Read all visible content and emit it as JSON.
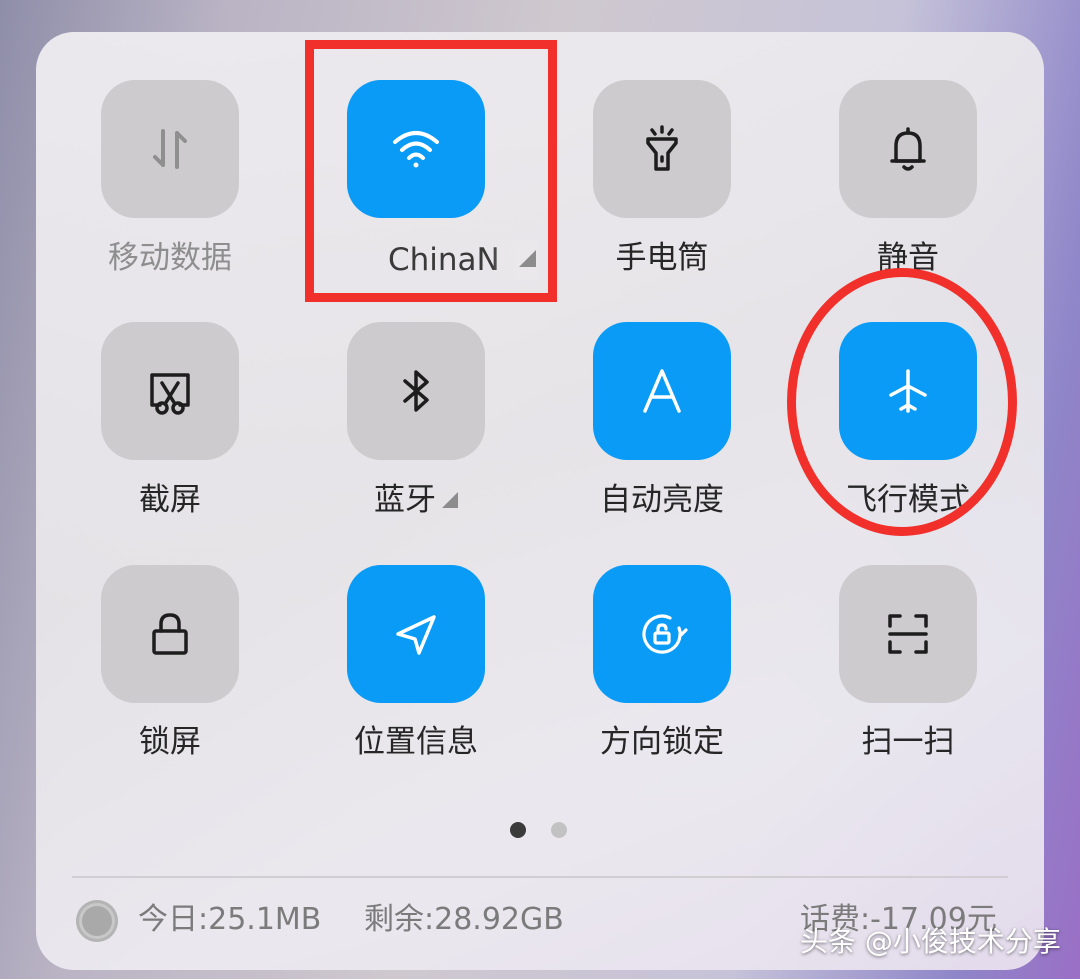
{
  "tiles": [
    {
      "id": "mobile-data",
      "label": "移动数据",
      "icon": "mobile-data-icon",
      "active": false
    },
    {
      "id": "wifi",
      "label": "ChinaN",
      "icon": "wifi-icon",
      "active": true
    },
    {
      "id": "flashlight",
      "label": "手电筒",
      "icon": "flashlight-icon",
      "active": false
    },
    {
      "id": "mute",
      "label": "静音",
      "icon": "bell-icon",
      "active": false
    },
    {
      "id": "screenshot",
      "label": "截屏",
      "icon": "scissors-screenshot-icon",
      "active": false
    },
    {
      "id": "bluetooth",
      "label": "蓝牙",
      "icon": "bluetooth-icon",
      "active": false
    },
    {
      "id": "auto-brightness",
      "label": "自动亮度",
      "icon": "auto-brightness-icon",
      "active": true
    },
    {
      "id": "airplane-mode",
      "label": "飞行模式",
      "icon": "airplane-icon",
      "active": true
    },
    {
      "id": "lock-screen",
      "label": "锁屏",
      "icon": "lock-icon",
      "active": false
    },
    {
      "id": "location",
      "label": "位置信息",
      "icon": "location-arrow-icon",
      "active": true
    },
    {
      "id": "rotation-lock",
      "label": "方向锁定",
      "icon": "rotation-lock-icon",
      "active": true
    },
    {
      "id": "scan",
      "label": "扫一扫",
      "icon": "scan-icon",
      "active": false
    }
  ],
  "pager": {
    "pages": 2,
    "current": 1
  },
  "status": {
    "today": "今日:25.1MB",
    "remaining": "剩余:28.92GB",
    "balance": "话费:-17.09元"
  },
  "watermark": "头条 @小俊技术分享",
  "colors": {
    "active_tile": "#0a9bf6",
    "inactive_tile": "#cdcbcd",
    "highlight": "#f2302b"
  }
}
